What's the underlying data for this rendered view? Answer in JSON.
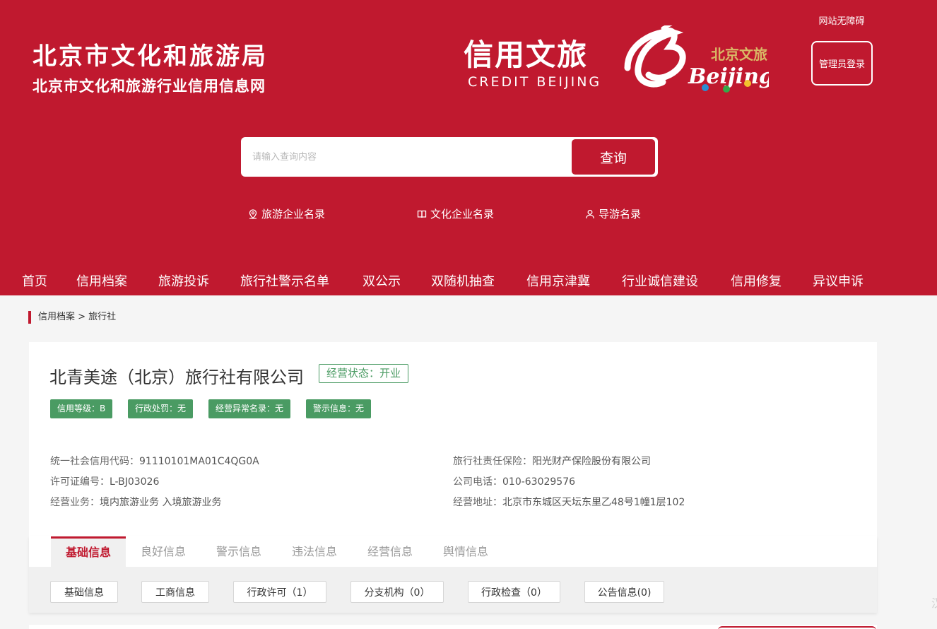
{
  "header": {
    "org_name": "北京市文化和旅游局",
    "site_name": "北京市文化和旅游行业信用信息网",
    "credit_logo_cn": "信用文旅",
    "credit_logo_en": "CREDIT BEIJING",
    "beijing_logo_cn": "北京文旅",
    "beijing_logo_en": "Beijing",
    "accessibility": "网站无障碍",
    "admin_login": "管理员登录"
  },
  "search": {
    "placeholder": "请输入查询内容",
    "button": "查询"
  },
  "quick_links": [
    {
      "label": "旅游企业名录",
      "icon": "location-pin-icon"
    },
    {
      "label": "文化企业名录",
      "icon": "book-icon"
    },
    {
      "label": "导游名录",
      "icon": "user-icon"
    }
  ],
  "nav": [
    "首页",
    "信用档案",
    "旅游投诉",
    "旅行社警示名单",
    "双公示",
    "双随机抽查",
    "信用京津冀",
    "行业诚信建设",
    "信用修复",
    "异议申诉"
  ],
  "breadcrumb": "信用档案 > 旅行社",
  "company": {
    "name": "北青美途（北京）旅行社有限公司",
    "status": "经营状态：开业",
    "tags": [
      "信用等级：B",
      "行政处罚：无",
      "经营异常名录：无",
      "警示信息：无"
    ],
    "info_left": [
      {
        "label": "统一社会信用代码：",
        "value": "91110101MA01C4QG0A"
      },
      {
        "label": "许可证编号：",
        "value": "L-BJ03026"
      },
      {
        "label": "经营业务：",
        "value": "境内旅游业务 入境旅游业务"
      }
    ],
    "info_right": [
      {
        "label": "旅行社责任保险：",
        "value": "阳光财产保险股份有限公司"
      },
      {
        "label": "公司电话：",
        "value": "010-63029576"
      },
      {
        "label": "经营地址：",
        "value": "北京市东城区天坛东里乙48号1幢1层102"
      }
    ]
  },
  "tabs": [
    "基础信息",
    "良好信息",
    "警示信息",
    "违法信息",
    "经营信息",
    "舆情信息"
  ],
  "active_tab": "基础信息",
  "sub_tabs": [
    "基础信息",
    "工商信息",
    "行政许可（1）",
    "分支机构（0）",
    "行政检查（0）",
    "公告信息(0)"
  ],
  "edge_glyph": "汉",
  "colors": {
    "brand_red": "#c0192f",
    "status_green": "#4a9b63",
    "background": "#f5f5f5"
  }
}
